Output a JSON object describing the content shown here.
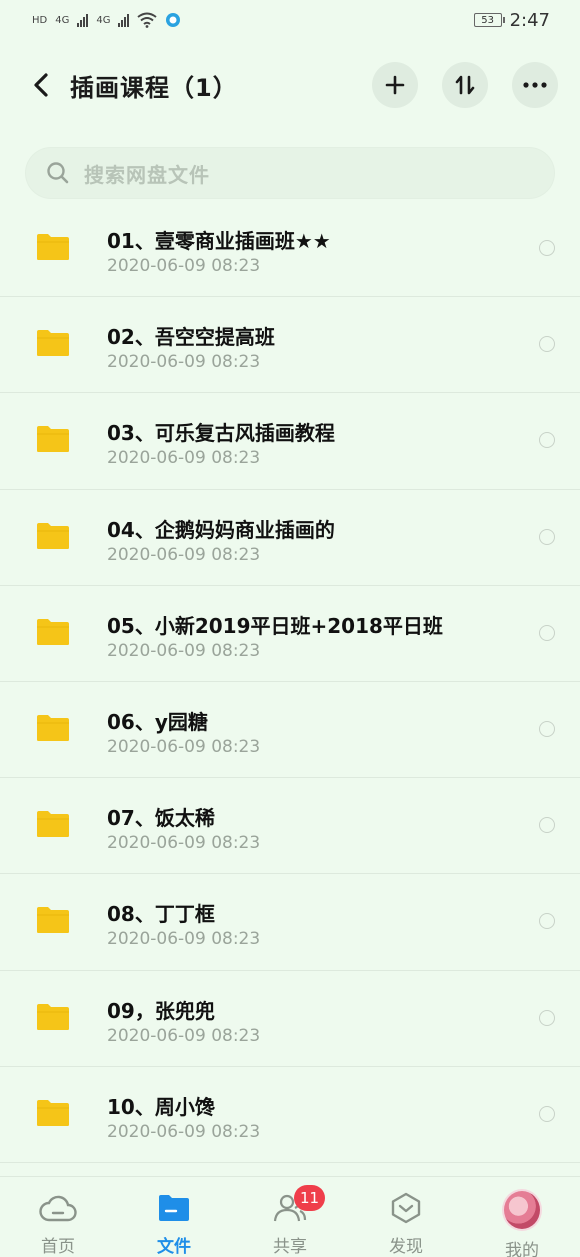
{
  "status_bar": {
    "network_left": "HD",
    "signal1": "4G",
    "signal2": "4G",
    "battery": "53",
    "time": "2:47"
  },
  "header": {
    "title": "插画课程（1）",
    "back_icon": "chevron-left-icon",
    "add_icon": "plus-icon",
    "sort_icon": "sort-icon",
    "more_icon": "more-horizontal-icon"
  },
  "search": {
    "placeholder": "搜索网盘文件"
  },
  "files": [
    {
      "name": "01、壹零商业插画班★★",
      "date": "2020-06-09  08:23"
    },
    {
      "name": "02、吾空空提高班",
      "date": "2020-06-09  08:23"
    },
    {
      "name": "03、可乐复古风插画教程",
      "date": "2020-06-09  08:23"
    },
    {
      "name": "04、企鹅妈妈商业插画的",
      "date": "2020-06-09  08:23"
    },
    {
      "name": "05、小新2019平日班+2018平日班",
      "date": "2020-06-09  08:23"
    },
    {
      "name": "06、y园糖",
      "date": "2020-06-09  08:23"
    },
    {
      "name": "07、饭太稀",
      "date": "2020-06-09  08:23"
    },
    {
      "name": "08、丁丁框",
      "date": "2020-06-09  08:23"
    },
    {
      "name": "09，张兜兜",
      "date": "2020-06-09  08:23"
    },
    {
      "name": "10、周小馋",
      "date": "2020-06-09  08:23"
    }
  ],
  "tabs": [
    {
      "label": "首页",
      "icon": "cloud-icon"
    },
    {
      "label": "文件",
      "icon": "folder-icon"
    },
    {
      "label": "共享",
      "icon": "people-icon",
      "badge": "11"
    },
    {
      "label": "发现",
      "icon": "discover-icon"
    },
    {
      "label": "我的",
      "icon": "avatar"
    }
  ],
  "colors": {
    "background": "#eefaee",
    "accent": "#1f8ee8",
    "folder": "#f5c518",
    "badge": "#ef3e4a"
  }
}
